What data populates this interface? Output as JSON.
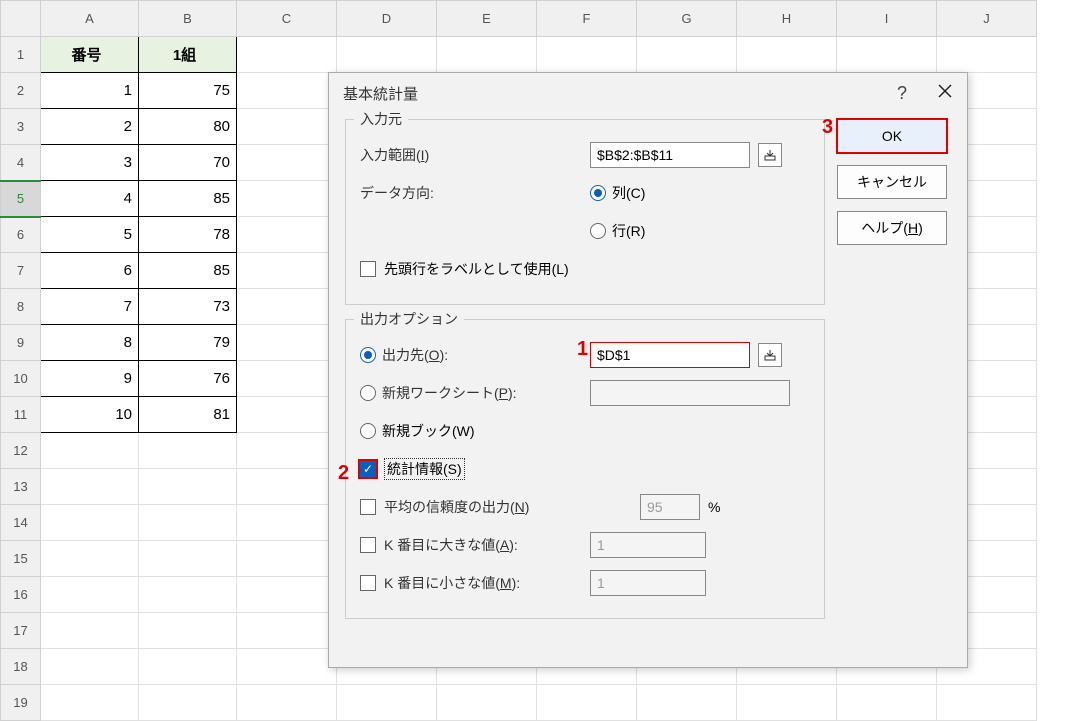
{
  "spreadsheet": {
    "columns": [
      "A",
      "B",
      "C",
      "D",
      "E",
      "F",
      "G",
      "H",
      "I",
      "J"
    ],
    "row_count": 19,
    "selected_row": 5,
    "headers": {
      "A1": "番号",
      "B1": "1組"
    },
    "data": [
      {
        "num": "1",
        "val": "75"
      },
      {
        "num": "2",
        "val": "80"
      },
      {
        "num": "3",
        "val": "70"
      },
      {
        "num": "4",
        "val": "85"
      },
      {
        "num": "5",
        "val": "78"
      },
      {
        "num": "6",
        "val": "85"
      },
      {
        "num": "7",
        "val": "73"
      },
      {
        "num": "8",
        "val": "79"
      },
      {
        "num": "9",
        "val": "76"
      },
      {
        "num": "10",
        "val": "81"
      }
    ]
  },
  "dialog": {
    "title": "基本統計量",
    "help_tooltip": "?",
    "close_tooltip": "×",
    "input_group": {
      "title": "入力元",
      "range_label_pre": "入力範囲(",
      "range_label_key": "I",
      "range_label_post": ")",
      "range_value": "$B$2:$B$11",
      "direction_label": "データ方向:",
      "radio_col_pre": "列(",
      "radio_col_key": "C",
      "radio_col_post": ")",
      "radio_row_pre": "行(",
      "radio_row_key": "R",
      "radio_row_post": ")",
      "labels_checkbox_pre": "先頭行をラベルとして使用(",
      "labels_checkbox_key": "L",
      "labels_checkbox_post": ")"
    },
    "output_group": {
      "title": "出力オプション",
      "radio_dest_pre": "出力先(",
      "radio_dest_key": "O",
      "radio_dest_post": "):",
      "dest_value": "$D$1",
      "radio_newsheet_pre": "新規ワークシート(",
      "radio_newsheet_key": "P",
      "radio_newsheet_post": "):",
      "radio_newbook_pre": "新規ブック(",
      "radio_newbook_key": "W",
      "radio_newbook_post": ")",
      "chk_stats_pre": "統計情報(",
      "chk_stats_key": "S",
      "chk_stats_post": ")",
      "chk_conf_pre": "平均の信頼度の出力(",
      "chk_conf_key": "N",
      "chk_conf_post": ")",
      "conf_value": "95",
      "conf_unit": "%",
      "chk_kth_large_pre": "K 番目に大きな値(",
      "chk_kth_large_key": "A",
      "chk_kth_large_post": "):",
      "kth_large_value": "1",
      "chk_kth_small_pre": "K 番目に小さな値(",
      "chk_kth_small_key": "M",
      "chk_kth_small_post": "):",
      "kth_small_value": "1"
    },
    "buttons": {
      "ok": "OK",
      "cancel": "キャンセル",
      "help_pre": "ヘルプ(",
      "help_key": "H",
      "help_post": ")"
    }
  },
  "annotations": {
    "a1": "1",
    "a2": "2",
    "a3": "3"
  }
}
